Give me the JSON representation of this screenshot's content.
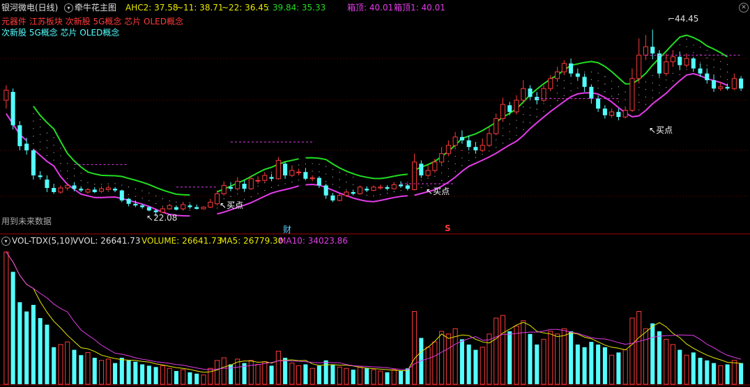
{
  "header": {
    "stock": "银河微电(日线)",
    "indicator": "牵牛花主图",
    "ahc2": "AHC2: 37.58",
    "v11": "~11: 38.71",
    "v22": "~22: 36.45",
    "v3": ": 39.84",
    "v4": ": 35.33",
    "box_top": "箱顶: 40.01",
    "box_top1": "箱顶1: 40.01"
  },
  "concepts": {
    "line1": "元器件 江苏板块 次新股 5G概念 芯片 OLED概念",
    "line2": "次新股 5G概念 芯片 OLED概念"
  },
  "annotations": {
    "future_data": "用到未来数据",
    "high": "44.45",
    "low": "22.08",
    "buy": "买点",
    "finance": "财",
    "s_mark": "S"
  },
  "volume_header": {
    "name": "VOL-TDX(5,10)",
    "vvol": "VVOL: 26641.73",
    "volume": "VOLUME: 26641.73",
    "ma5": "MA5: 26779.30",
    "ma10": "MA10: 34023.86"
  },
  "colors": {
    "up": "#ff3b3b",
    "down": "#54ffff",
    "green": "#22dd22",
    "magenta": "#e23ce8",
    "yellow": "#e8e800",
    "grid": "#7a0000",
    "white": "#ffffff"
  },
  "chart_data": {
    "type": "candlestick",
    "price_range": [
      21.5,
      46.5
    ],
    "volume_max": 100,
    "candles": [
      [
        36,
        37.2,
        35,
        37.8,
        100
      ],
      [
        37,
        33,
        32.5,
        37.4,
        85
      ],
      [
        33,
        30.5,
        30,
        33.5,
        62
      ],
      [
        30.8,
        30,
        29.5,
        31.5,
        55
      ],
      [
        30,
        27,
        26.5,
        30.2,
        60
      ],
      [
        27,
        26.8,
        26.5,
        27.5,
        50
      ],
      [
        26.5,
        25.5,
        25,
        27,
        45
      ],
      [
        25.5,
        25,
        24.8,
        26,
        28
      ],
      [
        25,
        25.5,
        24.8,
        25.8,
        30
      ],
      [
        25.5,
        25.8,
        25.2,
        26,
        32
      ],
      [
        25.8,
        25.4,
        25.1,
        26.2,
        26
      ],
      [
        25.4,
        25.2,
        25,
        25.7,
        22
      ],
      [
        25,
        25.3,
        24.8,
        25.5,
        24
      ],
      [
        25.3,
        25,
        24.9,
        25.6,
        20
      ],
      [
        25.1,
        25.4,
        24.9,
        25.7,
        18
      ],
      [
        25.3,
        25.5,
        25.2,
        25.8,
        19
      ],
      [
        25.4,
        25.2,
        25,
        25.6,
        16
      ],
      [
        25.2,
        24,
        23.8,
        25.3,
        20
      ],
      [
        24.2,
        23.6,
        23.3,
        24.3,
        18
      ],
      [
        23.6,
        23.4,
        23.2,
        24,
        17
      ],
      [
        23.4,
        23.2,
        23,
        23.6,
        15
      ],
      [
        23.2,
        22.8,
        22.7,
        23.3,
        14
      ],
      [
        22.8,
        22.6,
        22.1,
        23,
        13
      ],
      [
        22.6,
        23,
        22.5,
        23.2,
        14
      ],
      [
        23,
        23.4,
        22.9,
        23.6,
        12
      ],
      [
        23.2,
        22.9,
        22.8,
        23.4,
        10
      ],
      [
        23,
        23.5,
        22.9,
        23.8,
        11
      ],
      [
        23.4,
        23.2,
        23,
        23.6,
        9
      ],
      [
        23.2,
        23,
        22.9,
        23.5,
        8
      ],
      [
        23,
        23.2,
        22.9,
        23.3,
        7
      ],
      [
        23.2,
        23.8,
        23.1,
        24.2,
        12
      ],
      [
        23.6,
        24.8,
        23.4,
        25.2,
        18
      ],
      [
        24.8,
        25.8,
        24.6,
        26.3,
        20
      ],
      [
        25.6,
        25.4,
        25.1,
        26.2,
        15
      ],
      [
        25.4,
        26.3,
        25.2,
        26.8,
        19
      ],
      [
        26,
        25.4,
        25.1,
        26.4,
        16
      ],
      [
        25.4,
        26.6,
        25.3,
        27,
        18
      ],
      [
        26.4,
        26.4,
        26,
        26.9,
        15
      ],
      [
        26.4,
        27,
        26.2,
        27.4,
        17
      ],
      [
        26.8,
        26.6,
        26.3,
        27.2,
        14
      ],
      [
        26.6,
        28.8,
        26.5,
        29.2,
        25
      ],
      [
        28.4,
        27,
        26.6,
        28.6,
        20
      ],
      [
        27,
        27.6,
        26.8,
        28.2,
        16
      ],
      [
        27.4,
        27.4,
        27,
        27.8,
        14
      ],
      [
        27.4,
        26.6,
        26.4,
        27.9,
        15
      ],
      [
        26.6,
        26.7,
        26.3,
        27,
        12
      ],
      [
        26.7,
        25.8,
        25.5,
        26.9,
        14
      ],
      [
        25.8,
        24.6,
        24.2,
        26,
        18
      ],
      [
        24.6,
        24,
        23.8,
        24.9,
        15
      ],
      [
        24,
        24.6,
        23.9,
        24.8,
        13
      ],
      [
        24.6,
        25,
        24.4,
        25.2,
        12
      ],
      [
        25,
        24.8,
        24.6,
        25.3,
        11
      ],
      [
        24.8,
        25.6,
        24.7,
        25.8,
        13
      ],
      [
        25.4,
        25.2,
        25,
        25.7,
        12
      ],
      [
        25.2,
        25.6,
        25.1,
        25.8,
        11
      ],
      [
        25.5,
        25.6,
        25.3,
        25.9,
        10
      ],
      [
        25.6,
        25.4,
        25.2,
        25.8,
        9
      ],
      [
        25.4,
        25.9,
        25.3,
        26.2,
        11
      ],
      [
        25.9,
        25.7,
        25.5,
        26.3,
        10
      ],
      [
        25.8,
        25.4,
        25.2,
        26,
        12
      ],
      [
        25.3,
        28.6,
        25.2,
        29.6,
        55
      ],
      [
        28.4,
        27,
        26.7,
        28.8,
        35
      ],
      [
        27,
        27.6,
        26.8,
        28.2,
        28
      ],
      [
        27.6,
        28.6,
        27.3,
        29,
        32
      ],
      [
        28.6,
        29.6,
        28.3,
        30.4,
        40
      ],
      [
        29.6,
        30.6,
        29.3,
        31.2,
        38
      ],
      [
        30.6,
        31.6,
        30.3,
        32.2,
        42
      ],
      [
        31.6,
        31.2,
        30.8,
        32.4,
        34
      ],
      [
        31.2,
        30.4,
        30,
        31.8,
        30
      ],
      [
        30.4,
        30,
        29.6,
        31,
        26
      ],
      [
        30,
        30.6,
        29.8,
        31.4,
        28
      ],
      [
        30.6,
        32,
        30.4,
        32.8,
        38
      ],
      [
        32,
        33.8,
        31.8,
        34.4,
        50
      ],
      [
        33.8,
        35.5,
        33.4,
        36.3,
        52
      ],
      [
        35.4,
        34.6,
        34.2,
        35.8,
        40
      ],
      [
        34.6,
        36,
        34.3,
        36.6,
        44
      ],
      [
        36,
        37.4,
        35.6,
        38.4,
        48
      ],
      [
        37.4,
        36.4,
        36.1,
        37.8,
        38
      ],
      [
        36.4,
        36,
        35.5,
        37,
        30
      ],
      [
        36,
        37.4,
        35.8,
        37.8,
        34
      ],
      [
        37.4,
        38.6,
        37.1,
        39,
        40
      ],
      [
        38.6,
        39.4,
        38.2,
        40,
        38
      ],
      [
        39.4,
        40.4,
        39,
        40.8,
        42
      ],
      [
        40.4,
        39.2,
        38.8,
        41,
        40
      ],
      [
        39.2,
        38.8,
        38.4,
        39.8,
        30
      ],
      [
        38.8,
        37.6,
        37,
        39.2,
        28
      ],
      [
        37.6,
        36.2,
        35.6,
        37.9,
        32
      ],
      [
        36.2,
        35,
        34.6,
        36.6,
        30
      ],
      [
        35,
        34.2,
        33.8,
        35.4,
        28
      ],
      [
        34.2,
        34.6,
        33.9,
        35,
        22
      ],
      [
        34.6,
        34,
        33.6,
        35,
        24
      ],
      [
        34,
        34.8,
        33.8,
        35.2,
        26
      ],
      [
        34.8,
        38.6,
        34.6,
        39.8,
        50
      ],
      [
        38.6,
        41.4,
        38,
        43.4,
        55
      ],
      [
        41.4,
        42.4,
        40.8,
        43.8,
        42
      ],
      [
        42.4,
        41.6,
        40.9,
        44.45,
        46
      ],
      [
        41.6,
        39.2,
        38.8,
        42,
        40
      ],
      [
        39.2,
        40.6,
        38.9,
        41.6,
        34
      ],
      [
        40.6,
        41.2,
        40,
        42,
        30
      ],
      [
        41.2,
        40.2,
        39.6,
        41.8,
        26
      ],
      [
        40.2,
        41,
        39.9,
        41.6,
        22
      ],
      [
        41,
        39.8,
        39.4,
        41.2,
        24
      ],
      [
        39.8,
        39.2,
        38.8,
        40.4,
        20
      ],
      [
        39.2,
        38.4,
        38,
        39.8,
        18
      ],
      [
        38.4,
        37.4,
        37,
        39,
        16
      ],
      [
        37.4,
        37.6,
        37.1,
        38.2,
        14
      ],
      [
        37.6,
        37.4,
        37.2,
        38,
        15
      ],
      [
        37.4,
        38.6,
        37.2,
        39.2,
        18
      ],
      [
        38.6,
        37.4,
        37.1,
        38.9,
        16
      ]
    ]
  }
}
